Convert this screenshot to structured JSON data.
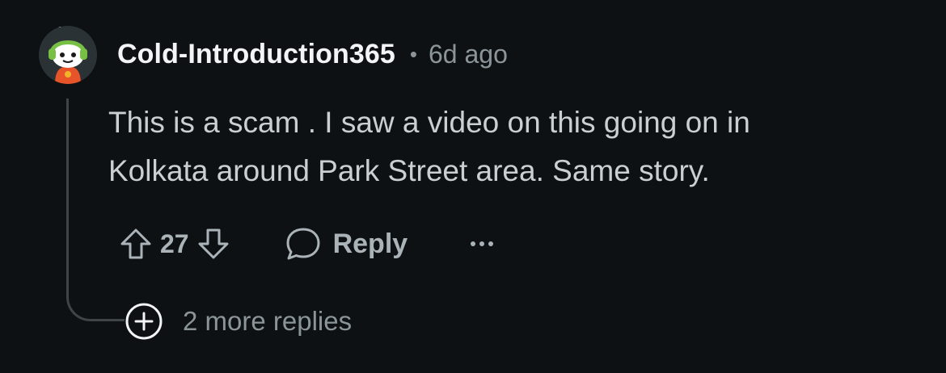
{
  "comment": {
    "username": "Cold-Introduction365",
    "separator": "•",
    "timestamp": "6d ago",
    "body_lines": [
      "This is a scam . I saw a video on this going on in",
      "Kolkata around Park Street area. Same story."
    ],
    "avatar_icon": "snoo-avatar-icon"
  },
  "actions": {
    "upvote_icon": "arrow-up-icon",
    "vote_count": "27",
    "downvote_icon": "arrow-down-icon",
    "reply_icon": "speech-bubble-icon",
    "reply_label": "Reply",
    "more_icon": "ellipsis-icon"
  },
  "thread": {
    "more_replies_icon": "plus-circle-icon",
    "more_replies_label": "2 more replies"
  },
  "colors": {
    "background": "#0e1113",
    "username": "#f2f4f5",
    "body_text": "#c9cfd2",
    "muted": "#8b9599",
    "thread_line": "#3e4447"
  }
}
